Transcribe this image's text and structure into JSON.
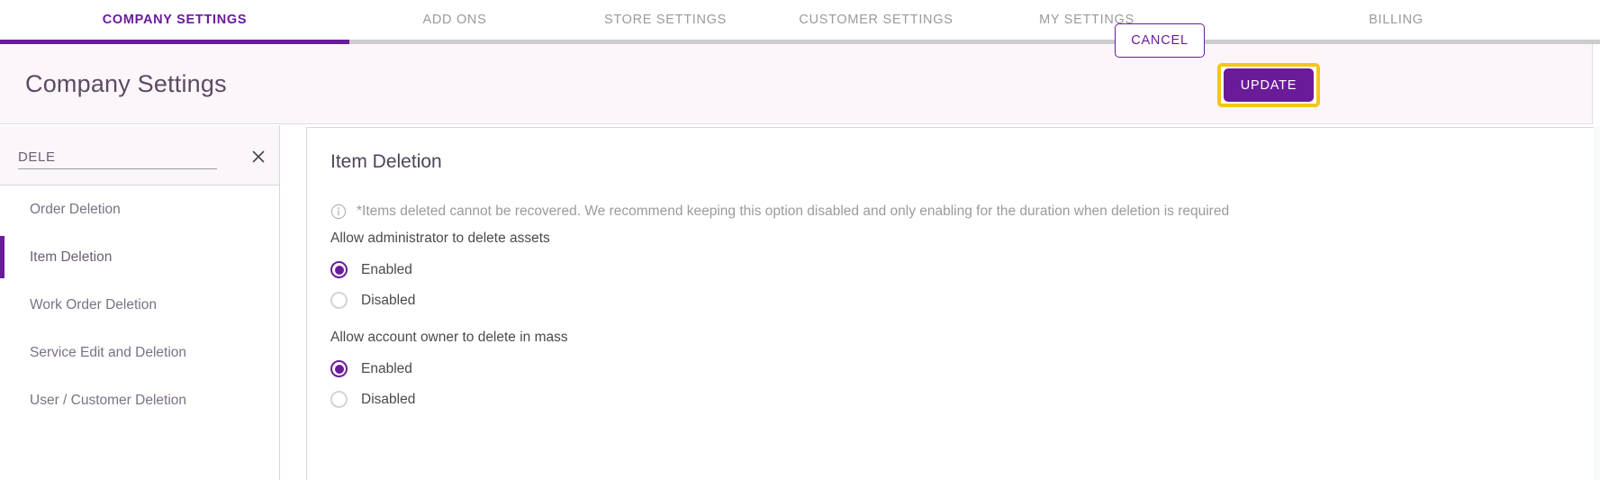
{
  "tabs": [
    {
      "label": "COMPANY SETTINGS",
      "active": true
    },
    {
      "label": "ADD ONS",
      "active": false
    },
    {
      "label": "STORE SETTINGS",
      "active": false
    },
    {
      "label": "CUSTOMER SETTINGS",
      "active": false
    },
    {
      "label": "MY SETTINGS",
      "active": false
    },
    {
      "label": "BILLING",
      "active": false
    }
  ],
  "header": {
    "title": "Company Settings",
    "cancel_label": "CANCEL",
    "update_label": "UPDATE",
    "highlight_color": "#f5c518"
  },
  "sidebar": {
    "search": {
      "value": "DELE",
      "placeholder": "Search",
      "clear_icon": "close-icon"
    },
    "items": [
      {
        "label": "Order Deletion",
        "active": false
      },
      {
        "label": "Item Deletion",
        "active": true
      },
      {
        "label": "Work Order Deletion",
        "active": false
      },
      {
        "label": "Service Edit and Deletion",
        "active": false
      },
      {
        "label": "User / Customer Deletion",
        "active": false
      }
    ]
  },
  "main": {
    "title": "Item Deletion",
    "info_icon": "info-icon",
    "info_text": "*Items deleted cannot be recovered. We recommend keeping this option disabled and only enabling for the duration when deletion is required",
    "groups": [
      {
        "label": "Allow administrator to delete assets",
        "options": [
          {
            "label": "Enabled",
            "selected": true
          },
          {
            "label": "Disabled",
            "selected": false
          }
        ]
      },
      {
        "label": "Allow account owner to delete in mass",
        "options": [
          {
            "label": "Enabled",
            "selected": true
          },
          {
            "label": "Disabled",
            "selected": false
          }
        ]
      }
    ]
  },
  "colors": {
    "accent": "#6a1b9a",
    "highlight": "#f5c518",
    "header_bg": "#faf6fa"
  }
}
